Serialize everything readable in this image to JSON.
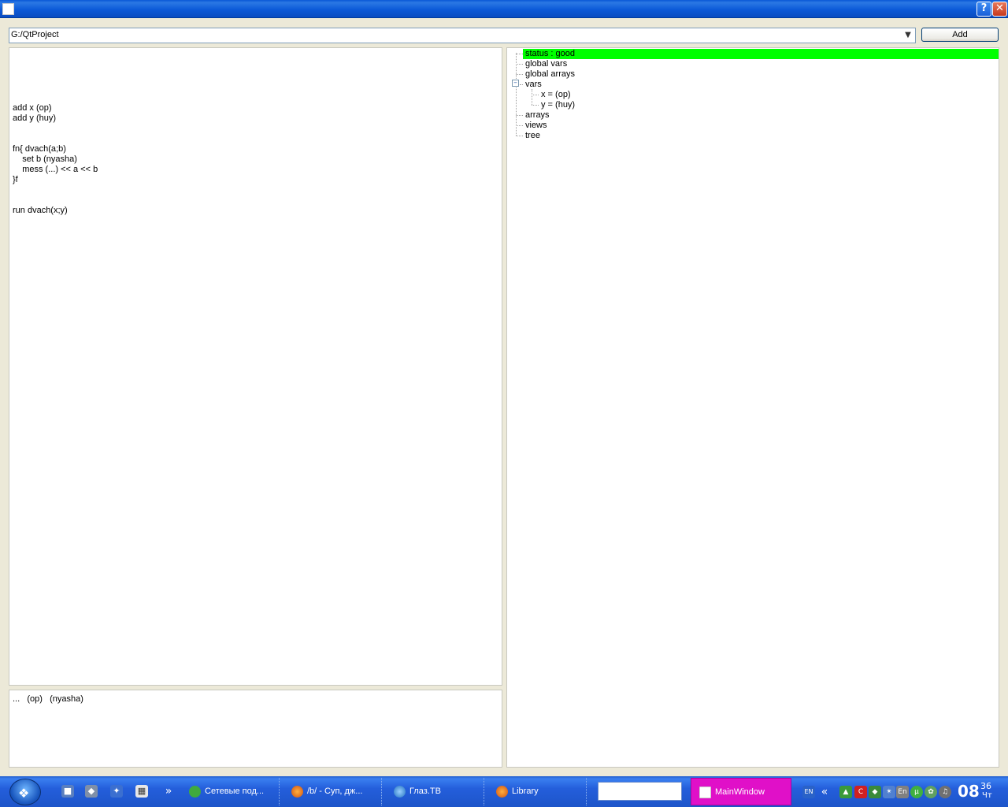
{
  "window": {
    "help_label": "?",
    "close_label": "✕"
  },
  "toolbar": {
    "path_value": "G:/QtProject",
    "add_label": "Add"
  },
  "editor": {
    "lines": [
      "add x (op)",
      "add y (huy)",
      "",
      "",
      "fn{ dvach(a;b)",
      "    set b (nyasha)",
      "    mess (...) << a << b",
      "}f",
      "",
      "",
      "run dvach(x;y)"
    ]
  },
  "output": {
    "text": "...   (op)   (nyasha)"
  },
  "tree": {
    "items": [
      {
        "label": "status : good",
        "level": 0,
        "highlight": true
      },
      {
        "label": "global vars",
        "level": 0
      },
      {
        "label": "global arrays",
        "level": 0
      },
      {
        "label": "vars",
        "level": 0,
        "expanded": true
      },
      {
        "label": "x = (op)",
        "level": 1
      },
      {
        "label": "y = (huy)",
        "level": 1
      },
      {
        "label": "arrays",
        "level": 0
      },
      {
        "label": "views",
        "level": 0
      },
      {
        "label": "tree",
        "level": 0
      }
    ],
    "highlight_color": "#00ff00"
  },
  "taskbar": {
    "overflow_label": "»",
    "tasks": [
      {
        "label": "Сетевые под..."
      },
      {
        "label": "/b/ - Суп, дж..."
      },
      {
        "label": "Глаз.ТВ"
      },
      {
        "label": "Library"
      },
      {
        "label": "MainWindow"
      }
    ],
    "tray": {
      "lang_short": "EN",
      "collapse_label": "«",
      "lang_badge": "En"
    },
    "clock": {
      "hour": "08",
      "minute": "36",
      "day": "Чт"
    },
    "active_task_color": "#e010c8"
  }
}
